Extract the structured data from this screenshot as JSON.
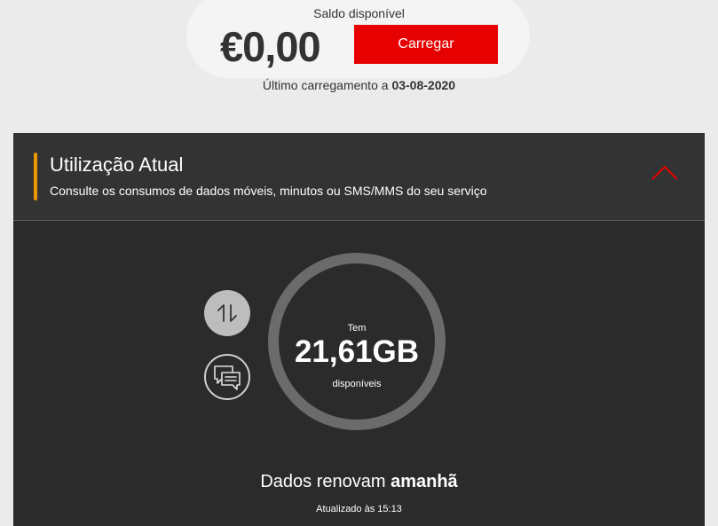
{
  "balance": {
    "label": "Saldo disponível",
    "amount": "€0,00",
    "topup_label": "Carregar",
    "last_topup_prefix": "Último carregamento a ",
    "last_topup_date": "03-08-2020"
  },
  "usage": {
    "title": "Utilização Atual",
    "subtitle": "Consulte os consumos de dados móveis, minutos ou SMS/MMS do seu serviço",
    "accent_color": "#eb9700",
    "toggle_icon": "chevron-up-icon",
    "toggle_color": "#e60000",
    "tabs": [
      {
        "icon": "data-transfer-icon",
        "selected": true
      },
      {
        "icon": "messages-icon",
        "selected": false
      }
    ],
    "ring": {
      "pre_label": "Tem",
      "value": "21,61GB",
      "post_label": "disponíveis"
    },
    "renew_prefix": "Dados renovam ",
    "renew_when": "amanhã",
    "updated": "Atualizado às 15:13"
  }
}
